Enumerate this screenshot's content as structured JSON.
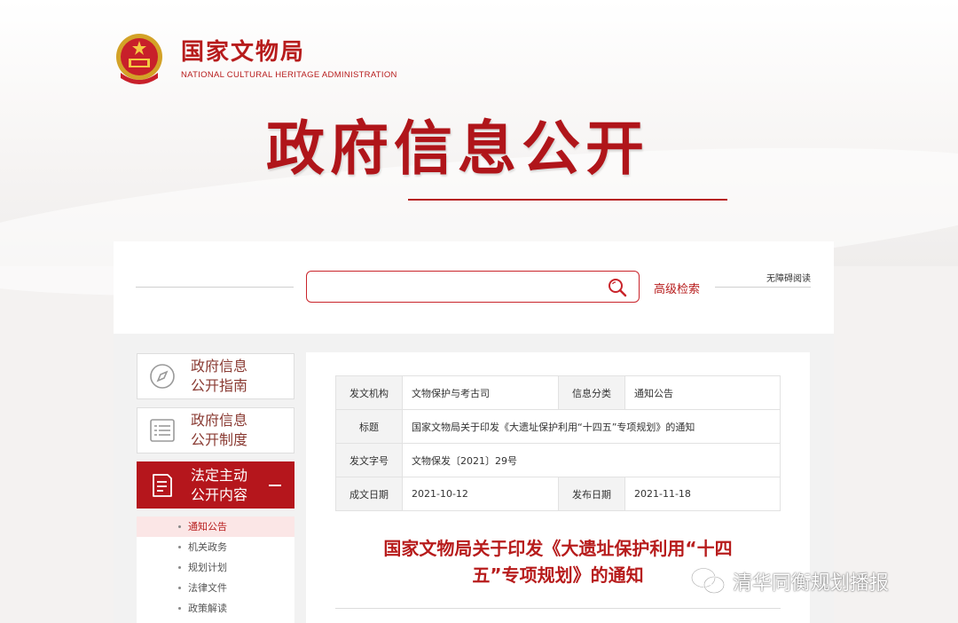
{
  "header": {
    "org_cn": "国家文物局",
    "org_en": "NATIONAL CULTURAL HERITAGE ADMINISTRATION",
    "page_title": "政府信息公开"
  },
  "search": {
    "placeholder": "",
    "advanced_label": "高级检索",
    "accessibility_label": "无障碍阅读"
  },
  "sidebar": {
    "cards": [
      {
        "label_line1": "政府信息",
        "label_line2": "公开指南",
        "icon": "compass-icon"
      },
      {
        "label_line1": "政府信息",
        "label_line2": "公开制度",
        "icon": "list-icon"
      },
      {
        "label_line1": "法定主动",
        "label_line2": "公开内容",
        "icon": "document-icon"
      }
    ],
    "sub_items": [
      "通知公告",
      "机关政务",
      "规划计划",
      "法律文件",
      "政策解读"
    ]
  },
  "meta": {
    "issuer_key": "发文机构",
    "issuer_value": "文物保护与考古司",
    "category_key": "信息分类",
    "category_value": "通知公告",
    "title_key": "标题",
    "title_value": "国家文物局关于印发《大遗址保护利用“十四五”专项规划》的通知",
    "docno_key": "发文字号",
    "docno_value": "文物保发〔2021〕29号",
    "date_key": "成文日期",
    "date_value": "2021-10-12",
    "pubdate_key": "发布日期",
    "pubdate_value": "2021-11-18"
  },
  "document": {
    "title_line1": "国家文物局关于印发《大遗址保护利用“十四",
    "title_line2": "五”专项规划》的通知"
  },
  "watermark": {
    "text": "清华同衡规划播报"
  },
  "colors": {
    "brand_red": "#b71c1c",
    "active_red": "#b5161c"
  }
}
